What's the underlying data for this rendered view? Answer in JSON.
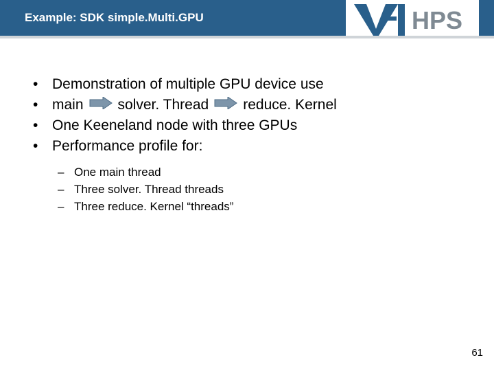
{
  "header": {
    "title": "Example: SDK simple.Multi.GPU",
    "logo_text": "VI-HPS"
  },
  "bullets": [
    {
      "text": "Demonstration of multiple GPU device use"
    },
    {
      "flow": {
        "a": "main",
        "b": "solver. Thread",
        "c": "reduce. Kernel"
      }
    },
    {
      "text": "One Keeneland node with three GPUs"
    },
    {
      "text": "Performance profile for:"
    }
  ],
  "sub": [
    "One main thread",
    "Three solver. Thread threads",
    "Three reduce. Kernel “threads”"
  ],
  "page_number": "61",
  "colors": {
    "band": "#295f8b",
    "arrow": "#6f8ea8"
  }
}
